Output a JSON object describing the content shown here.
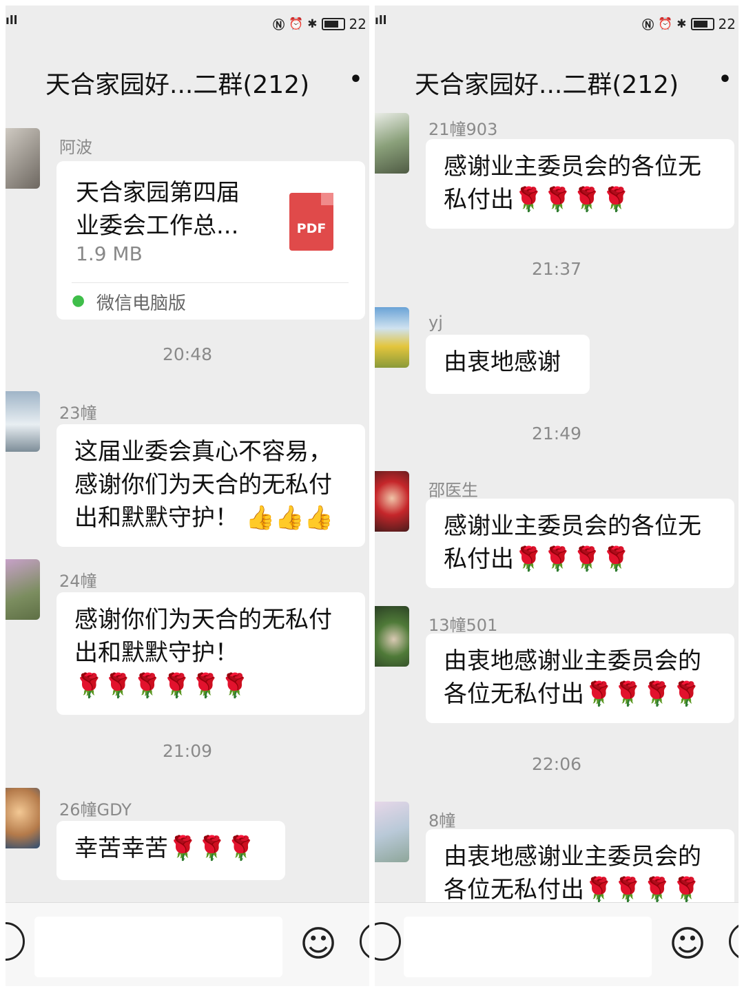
{
  "colors": {
    "background": "#ededed",
    "bubble": "#ffffff",
    "meta_text": "#8a8a8a",
    "pdf_red": "#e04a4a",
    "wechat_green": "#3fbe4a"
  },
  "status_bar": {
    "left": {
      "signal_icon": "wifi-icon",
      "time_fragment": "22"
    },
    "right": {
      "time_fragment": "22"
    }
  },
  "left": {
    "title": "天合家园好...二群(212)",
    "more": "•",
    "file_message": {
      "sender": "阿波",
      "file_name": "天合家园第四届\n业委会工作总...",
      "file_size": "1.9 MB",
      "file_type": "PDF",
      "source": "微信电脑版"
    },
    "time_1": "20:48",
    "msg_23": {
      "sender": "23幢",
      "text": "这届业委会真心不容易，\n感谢你们为天合的无私付\n出和默默守护！ 👍👍👍"
    },
    "msg_24": {
      "sender": "24幢",
      "text": "感谢你们为天合的无私付\n出和默默守护！\n🌹🌹🌹🌹🌹🌹"
    },
    "time_2": "21:09",
    "msg_26": {
      "sender": "26幢GDY",
      "text": "幸苦幸苦🌹🌹🌹"
    }
  },
  "right": {
    "title": "天合家园好...二群(212)",
    "more": "•",
    "msg_21": {
      "sender": "21幢903",
      "text": "感谢业主委员会的各位无\n私付出🌹🌹🌹🌹"
    },
    "time_1": "21:37",
    "msg_yj": {
      "sender": "yj",
      "text": "由衷地感谢"
    },
    "time_2": "21:49",
    "msg_shao": {
      "sender": "邵医生",
      "text": "感谢业主委员会的各位无\n私付出🌹🌹🌹🌹"
    },
    "msg_13": {
      "sender": "13幢501",
      "text": "由衷地感谢业主委员会的\n各位无私付出🌹🌹🌹🌹"
    },
    "time_3": "22:06",
    "msg_8": {
      "sender": "8幢",
      "text": "由衷地感谢业主委员会的\n各位无私付出🌹🌹🌹🌹"
    }
  },
  "input_bar": {
    "emoji_icon": "☺"
  }
}
